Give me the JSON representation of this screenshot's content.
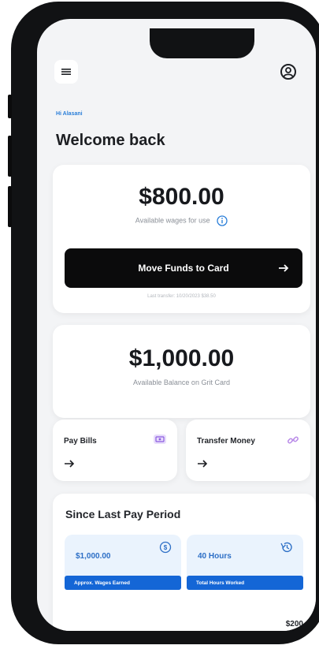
{
  "header": {
    "greeting": "Hi Alasani",
    "welcome": "Welcome back"
  },
  "wages_card": {
    "amount": "$800.00",
    "label": "Available wages for use",
    "button_label": "Move Funds to Card",
    "last_transfer": "Last transfer: 10/20/2023 $38.50"
  },
  "balance_card": {
    "amount": "$1,000.00",
    "label": "Available Balance on Grit Card"
  },
  "actions": {
    "pay_bills": "Pay Bills",
    "transfer_money": "Transfer Money"
  },
  "pay_period": {
    "title": "Since Last Pay Period",
    "wages_value": "$1,000.00",
    "wages_tag": "Approx. Wages Earned",
    "hours_value": "40 Hours",
    "hours_tag": "Total Hours Worked",
    "bar_label": "$200"
  },
  "colors": {
    "accent": "#1466d6",
    "dark": "#0b0b0c",
    "background": "#f3f4f6"
  }
}
